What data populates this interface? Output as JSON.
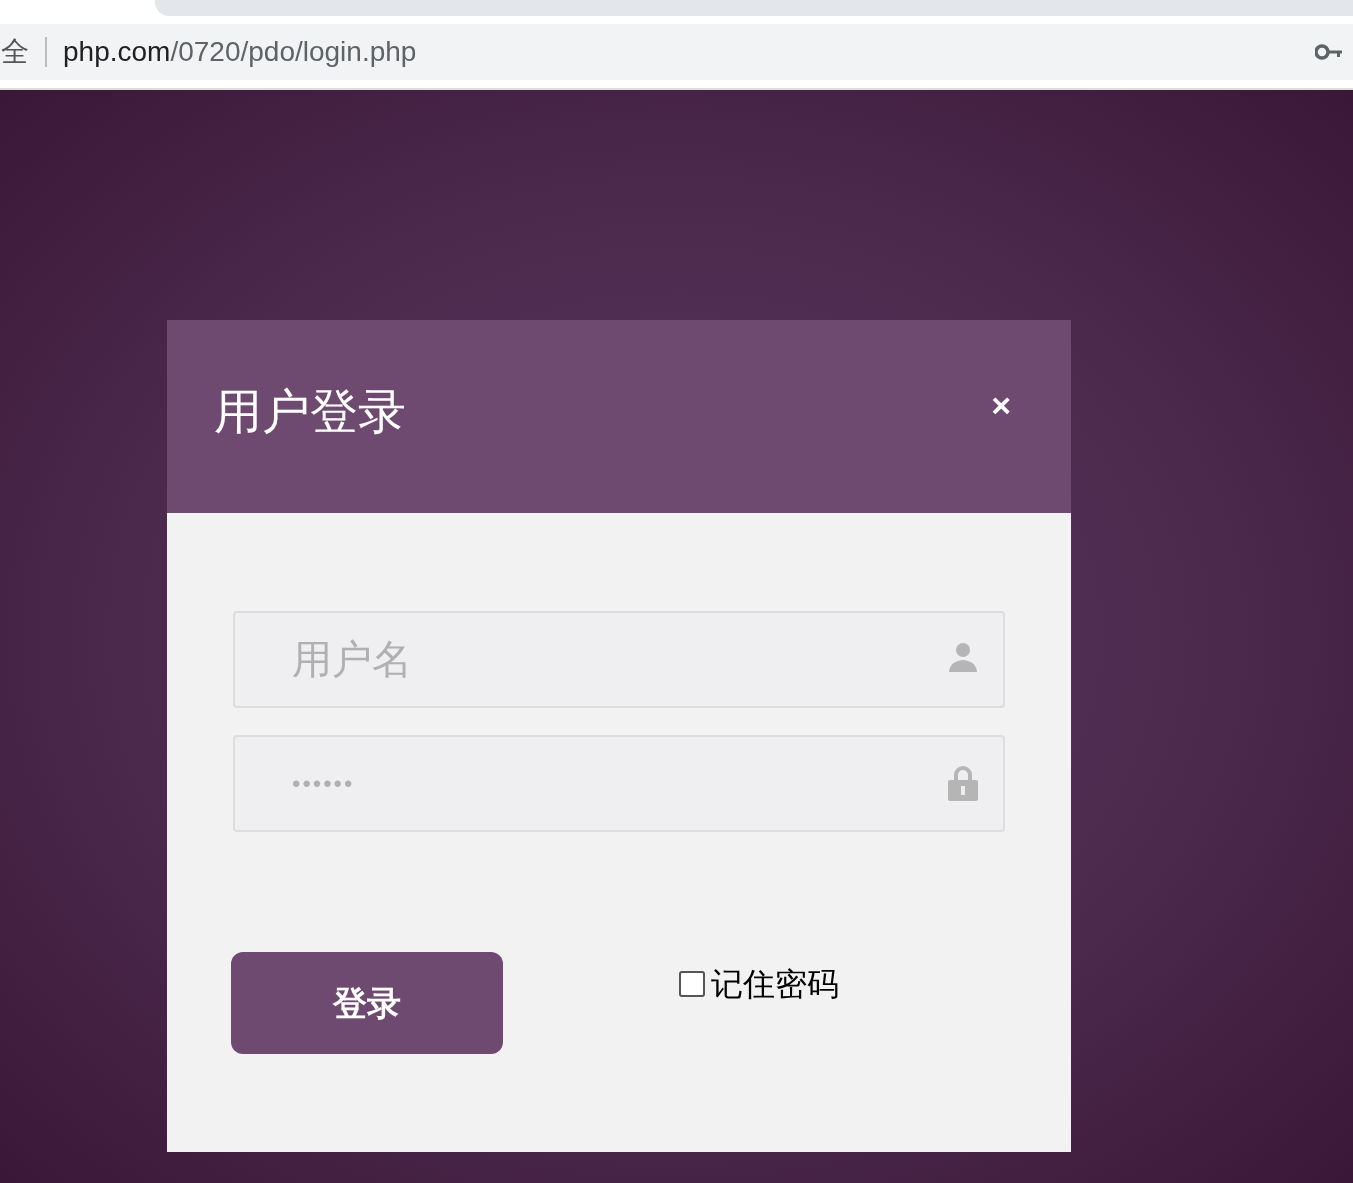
{
  "browser": {
    "security_label": "全",
    "url_host": "php.com",
    "url_path": "/0720/pdo/login.php"
  },
  "dialog": {
    "title": "用户登录",
    "close": "×"
  },
  "fields": [
    {
      "kind": "text",
      "placeholder": "用户名"
    },
    {
      "kind": "password",
      "placeholder": "••••••"
    }
  ],
  "login_button": "登录",
  "remember": {
    "label": "记住密码",
    "checked": false
  }
}
